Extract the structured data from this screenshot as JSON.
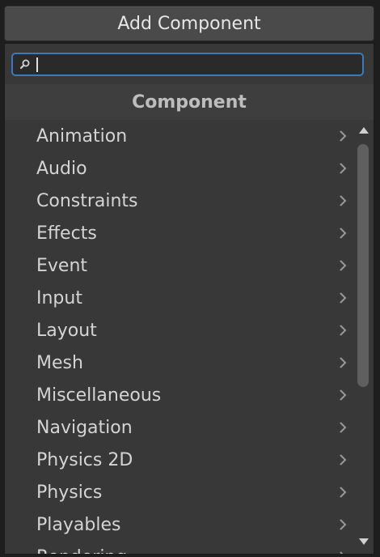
{
  "add_button": {
    "label": "Add Component"
  },
  "search": {
    "value": "",
    "placeholder": ""
  },
  "header": {
    "title": "Component"
  },
  "items": [
    {
      "label": "Animation"
    },
    {
      "label": "Audio"
    },
    {
      "label": "Constraints"
    },
    {
      "label": "Effects"
    },
    {
      "label": "Event"
    },
    {
      "label": "Input"
    },
    {
      "label": "Layout"
    },
    {
      "label": "Mesh"
    },
    {
      "label": "Miscellaneous"
    },
    {
      "label": "Navigation"
    },
    {
      "label": "Physics 2D"
    },
    {
      "label": "Physics"
    },
    {
      "label": "Playables"
    },
    {
      "label": "Rendering"
    }
  ],
  "icons": {
    "search": "search-icon",
    "chevron": "chevron-right-icon",
    "scroll_up": "scroll-up-arrow-icon",
    "scroll_down": "scroll-down-arrow-icon"
  },
  "colors": {
    "focus_border": "#3a79bb",
    "panel_bg": "#383838",
    "button_bg": "#4a4a4a"
  }
}
